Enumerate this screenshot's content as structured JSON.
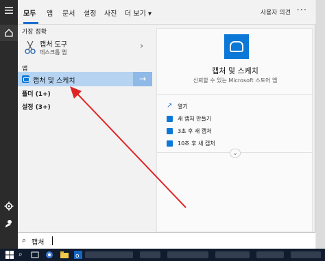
{
  "tabs": {
    "items": [
      "모두",
      "앱",
      "문서",
      "설정",
      "사진",
      "더 보기"
    ],
    "more_arrow": "▾",
    "feedback": "사용자 의견",
    "more_options": "···"
  },
  "rail": {
    "menu_icon": "hamburger-icon",
    "home_icon": "home-icon",
    "settings_icon": "gear-icon",
    "user_icon": "user-icon"
  },
  "best_match": {
    "header": "가장 정확",
    "name": "캡처 도구",
    "subtitle": "데스크톱 앱",
    "chevron": "›"
  },
  "apps": {
    "header": "앱",
    "selected_item": "캡처 및 스케치",
    "arrow": "→"
  },
  "groups": {
    "folders": "폴더 (1+)",
    "settings": "설정 (3+)"
  },
  "detail": {
    "title": "캡처 및 스케치",
    "subtitle": "신뢰할 수 있는 Microsoft 스토어 앱",
    "actions": [
      "열기",
      "새 캡처 만들기",
      "3초 후 새 캡처",
      "10초 후 새 캡처"
    ],
    "expand": "⌄"
  },
  "search": {
    "icon": "search-icon",
    "value": "캡처"
  },
  "colors": {
    "accent": "#1f6fcf",
    "selection": "#b6d4f2",
    "app_blue": "#0b78d7",
    "annotation_arrow": "#e02424"
  }
}
